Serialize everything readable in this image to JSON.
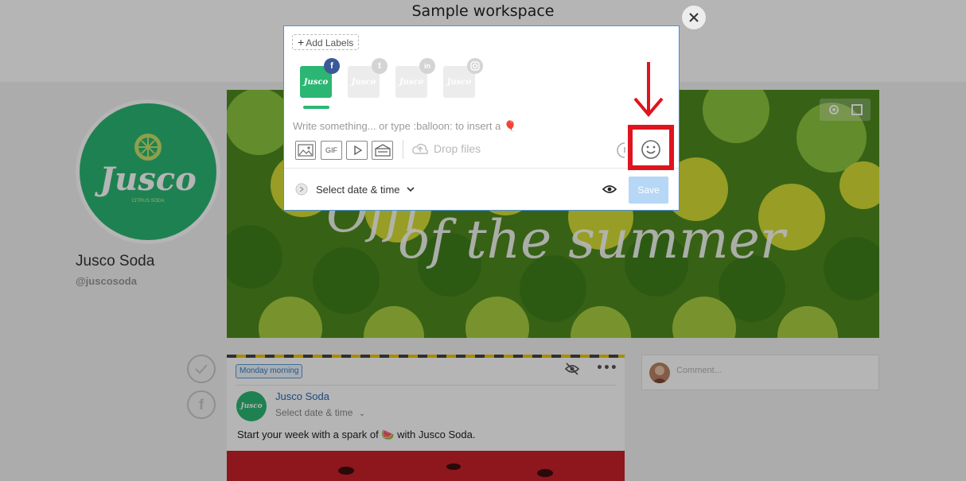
{
  "workspace": {
    "title": "Sample workspace",
    "close_icon": "close-icon"
  },
  "profile": {
    "name": "Jusco Soda",
    "handle": "@juscosoda",
    "logo_text": "Jusco",
    "logo_subtext": "CITRUS SODA",
    "brand_color": "#2bb673"
  },
  "cover": {
    "line1": "Offi",
    "line2": "of the summer"
  },
  "post": {
    "label": "Monday morning",
    "author": "Jusco Soda",
    "date_placeholder": "Select date & time",
    "text": "Start your week with a spark of 🍉 with Jusco Soda."
  },
  "comment": {
    "placeholder": "Comment..."
  },
  "composer": {
    "add_labels": "Add Labels",
    "accounts": [
      {
        "network": "facebook",
        "badge": "f",
        "badge_color": "#3b5998",
        "selected": true
      },
      {
        "network": "twitter",
        "badge": "t",
        "badge_color": "#cfcfcf",
        "selected": false
      },
      {
        "network": "linkedin",
        "badge": "in",
        "badge_color": "#cfcfcf",
        "selected": false
      },
      {
        "network": "instagram",
        "badge": "ig",
        "badge_color": "#cfcfcf",
        "selected": false
      }
    ],
    "placeholder": "Write something... or type :balloon: to insert a 🎈",
    "gif_label": "GIF",
    "drop_files": "Drop files",
    "schedule": "Select date & time",
    "save": "Save"
  },
  "colors": {
    "accent": "#4a90d9",
    "highlight": "#e0141e",
    "save_disabled": "#b6d7f6"
  }
}
